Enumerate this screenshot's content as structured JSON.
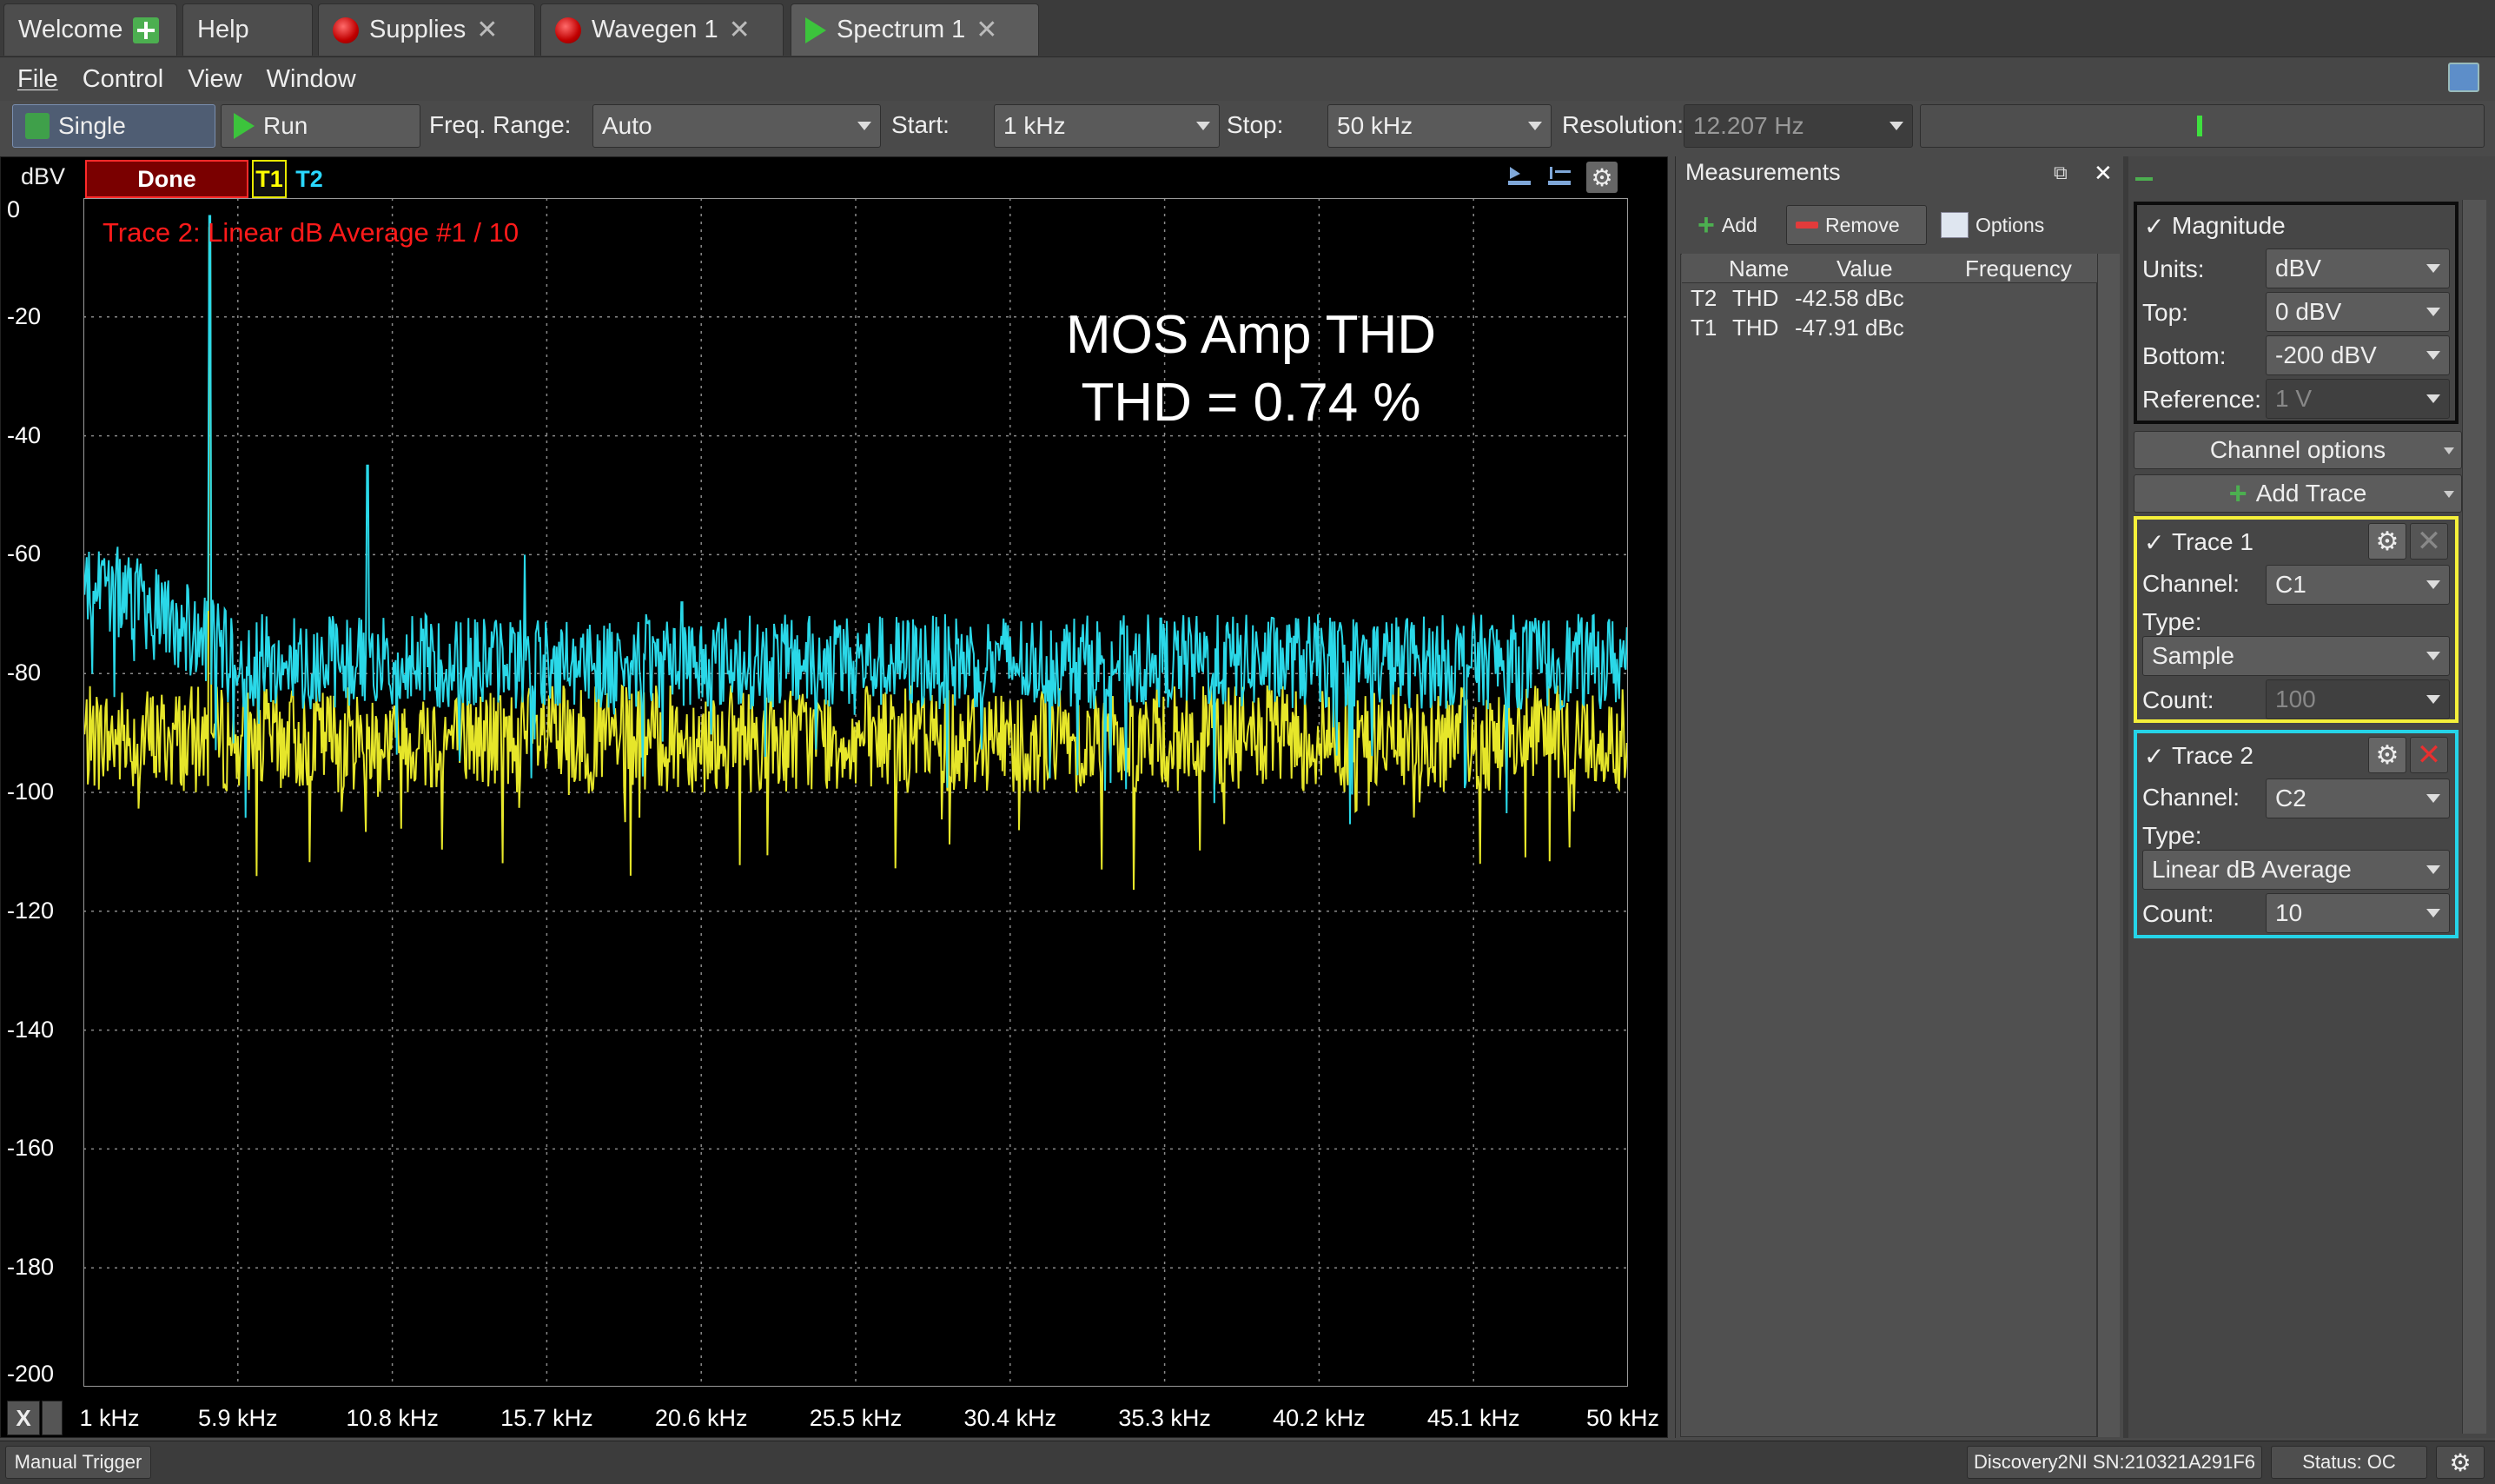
{
  "tabs": [
    {
      "label": "Welcome",
      "icon": "plus-icon"
    },
    {
      "label": "Help"
    },
    {
      "label": "Supplies",
      "icon": "stop-icon"
    },
    {
      "label": "Wavegen 1",
      "icon": "stop-icon"
    },
    {
      "label": "Spectrum 1",
      "icon": "run-icon",
      "active": true
    }
  ],
  "menu": {
    "file": "File",
    "control": "Control",
    "view": "View",
    "window": "Window"
  },
  "toolbar": {
    "single": "Single",
    "run": "Run",
    "freq_range_label": "Freq. Range:",
    "freq_range_value": "Auto",
    "start_label": "Start:",
    "start_value": "1 kHz",
    "stop_label": "Stop:",
    "stop_value": "50 kHz",
    "resolution_label": "Resolution:",
    "resolution_value": "12.207 Hz"
  },
  "plot": {
    "unit": "dBV",
    "status": "Done",
    "t1": "T1",
    "t2": "T2",
    "trace_status": "Trace 2: Linear dB Average #1 / 10",
    "annotation_title": "MOS Amp THD",
    "annotation_value": "THD = 0.74 %",
    "x_btn": "X"
  },
  "chart_data": {
    "type": "line",
    "title": "",
    "xlabel": "",
    "ylabel": "dBV",
    "x_ticks": [
      "1 kHz",
      "5.9 kHz",
      "10.8 kHz",
      "15.7 kHz",
      "20.6 kHz",
      "25.5 kHz",
      "30.4 kHz",
      "35.3 kHz",
      "40.2 kHz",
      "45.1 kHz",
      "50 kHz"
    ],
    "y_ticks": [
      "0",
      "-20",
      "-40",
      "-60",
      "-80",
      "-100",
      "-120",
      "-140",
      "-160",
      "-180",
      "-200"
    ],
    "xlim": [
      1,
      50
    ],
    "ylim": [
      -200,
      0
    ],
    "x_unit": "kHz",
    "grid": true,
    "series": [
      {
        "name": "T1",
        "color": "#e6e62a",
        "noise_floor": -91,
        "noise_span": 9,
        "peaks_khz": [
          5
        ],
        "peaks_db": [
          -5
        ]
      },
      {
        "name": "T2",
        "color": "#2ad8e8",
        "noise_floor": -78,
        "noise_span": 8,
        "peaks_khz": [
          5,
          10,
          15,
          20,
          25,
          30,
          35,
          40,
          45
        ],
        "peaks_db": [
          -3,
          -45,
          -60,
          -68,
          -72,
          -75,
          -77,
          -78,
          -79
        ]
      }
    ]
  },
  "measurements": {
    "title": "Measurements",
    "add": "Add",
    "remove": "Remove",
    "options": "Options",
    "headers": [
      "Name",
      "Value",
      "Frequency"
    ],
    "rows": [
      {
        "trace": "T2",
        "name": "THD",
        "value": "-42.58 dBc",
        "frequency": ""
      },
      {
        "trace": "T1",
        "name": "THD",
        "value": "-47.91 dBc",
        "frequency": ""
      }
    ]
  },
  "magnitude": {
    "title": "Magnitude",
    "units_label": "Units:",
    "units_value": "dBV",
    "top_label": "Top:",
    "top_value": "0 dBV",
    "bottom_label": "Bottom:",
    "bottom_value": "-200 dBV",
    "reference_label": "Reference:",
    "reference_value": "1 V"
  },
  "channel_options": "Channel options",
  "add_trace": "Add Trace",
  "trace1": {
    "title": "Trace 1",
    "color": "#f5f03a",
    "channel_label": "Channel:",
    "channel_value": "C1",
    "type_label": "Type:",
    "type_value": "Sample",
    "count_label": "Count:",
    "count_value": "100"
  },
  "trace2": {
    "title": "Trace 2",
    "color": "#25d4e8",
    "channel_label": "Channel:",
    "channel_value": "C2",
    "type_label": "Type:",
    "type_value": "Linear dB Average",
    "count_label": "Count:",
    "count_value": "10"
  },
  "status": {
    "manual_trigger": "Manual Trigger",
    "device": "Discovery2NI SN:210321A291F6",
    "status": "Status: OC"
  },
  "check_mark": "✓",
  "close_glyph": "✕"
}
